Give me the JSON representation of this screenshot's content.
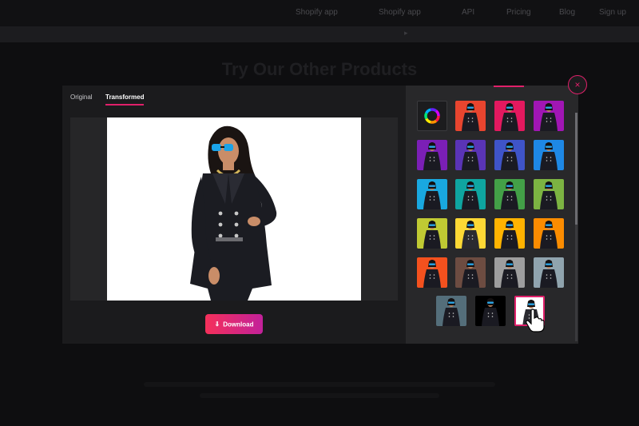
{
  "background_page": {
    "nav_items": [
      "Shopify app",
      "Shopify app",
      "API",
      "Pricing",
      "Blog",
      "Sign up"
    ],
    "heading": "Try Our Other Products"
  },
  "modal": {
    "tabs": [
      {
        "label": "Original",
        "active": false
      },
      {
        "label": "Transformed",
        "active": true
      }
    ],
    "download_label": "Download",
    "close_symbol": "×",
    "accent_color": "#e0206a",
    "color_picker_icon": "color-wheel-icon",
    "swatches": [
      {
        "color": "#e8452f"
      },
      {
        "color": "#e3195f"
      },
      {
        "color": "#a116b4"
      },
      {
        "color": "#7b1fb6"
      },
      {
        "color": "#5a34b6"
      },
      {
        "color": "#3f54c8"
      },
      {
        "color": "#1e88e5"
      },
      {
        "color": "#19a8e0"
      },
      {
        "color": "#0fa5a0"
      },
      {
        "color": "#43a047"
      },
      {
        "color": "#7cb342"
      },
      {
        "color": "#c0ca33"
      },
      {
        "color": "#fdd835"
      },
      {
        "color": "#ffb300"
      },
      {
        "color": "#fb8c00"
      },
      {
        "color": "#f4511e"
      },
      {
        "color": "#6d4c41"
      },
      {
        "color": "#9e9e9e"
      },
      {
        "color": "#90a4ae"
      },
      {
        "color": "#546e7a"
      },
      {
        "color": "#000000"
      },
      {
        "color": "#ffffff",
        "selected": true
      }
    ]
  }
}
